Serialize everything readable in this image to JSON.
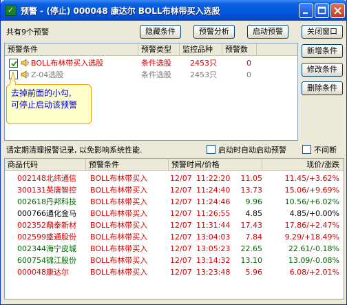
{
  "window": {
    "title": "预警 - (停止) 000048 康达尔 BOLL布林带买入选股",
    "controls": {
      "minimize": "minimize",
      "maximize": "maximize",
      "close": "close"
    }
  },
  "top_bar": {
    "count_label": "共有9个预警",
    "buttons": {
      "hide": "隐藏条件",
      "analyze": "预警分析",
      "start": "启动预警",
      "close_window": "关闭窗口"
    }
  },
  "side_buttons": {
    "add": "新增条件",
    "edit": "修改条件",
    "delete": "删除条件"
  },
  "conditions_table": {
    "columns": [
      "预警条件",
      "预警类型",
      "监控品种",
      "预警数"
    ],
    "rows": [
      {
        "name": "BOLL布林带买入选股",
        "type": "条件选股",
        "monitor": "2453只",
        "count": "0",
        "checked": true,
        "color": "red"
      },
      {
        "name": "Z-04选股",
        "type": "条件选股",
        "monitor": "2453只",
        "count": "0",
        "checked": false,
        "color": "gray"
      }
    ]
  },
  "tooltip": {
    "line1": "去掉前面的小勾,",
    "line2": "可停止启动该预警"
  },
  "options": {
    "notice": "请定期清理报警记录, 以免影响系统性能.",
    "auto_start": "启动时自动启动预警",
    "no_interrupt": "不间断"
  },
  "records_table": {
    "columns": [
      "商品代码",
      "预警条件",
      "预警时间/价格",
      "现价/涨跌"
    ],
    "rows": [
      {
        "code": "002148北纬通信",
        "cond": "BOLL布林带买入",
        "date": "12/07",
        "time": "11:22:20",
        "price": "11.05",
        "now": "11.45/+3.62%",
        "color": "red"
      },
      {
        "code": "300131英唐智控",
        "cond": "BOLL布林带买入",
        "date": "12/07",
        "time": "11:24:40",
        "price": "13.73",
        "now": "15.06/+9.69%",
        "color": "red"
      },
      {
        "code": "002618丹邦科技",
        "cond": "BOLL布林带买入",
        "date": "12/07",
        "time": "11:24:46",
        "price": "9.96",
        "now": "10.56/+6.02%",
        "color": "green"
      },
      {
        "code": "000766通化金马",
        "cond": "BOLL布林带买入",
        "date": "12/07",
        "time": "11:26:55",
        "price": "4.85",
        "now": "4.85/+0.00%",
        "color": "black"
      },
      {
        "code": "002352鼎泰新材",
        "cond": "BOLL布林带买入",
        "date": "12/07",
        "time": "11:31:44",
        "price": "17.43",
        "now": "17.86/+2.47%",
        "color": "red"
      },
      {
        "code": "002599盛通股份",
        "cond": "BOLL布林带买入",
        "date": "12/07",
        "time": "13:04:03",
        "price": "7.84",
        "now": "9.29/+18.49%",
        "color": "red"
      },
      {
        "code": "002344海宁皮城",
        "cond": "BOLL布林带买入",
        "date": "12/07",
        "time": "13:05:23",
        "price": "22.65",
        "now": "22.61/-0.18%",
        "color": "green"
      },
      {
        "code": "600754锦江股份",
        "cond": "BOLL布林带买入",
        "date": "12/07",
        "time": "13:14:32",
        "price": "13.10",
        "now": "13.09/-0.08%",
        "color": "green"
      },
      {
        "code": "000048康达尔",
        "cond": "BOLL布林带买入",
        "date": "12/07",
        "time": "13:23:48",
        "price": "5.96",
        "now": "6.08/+2.01%",
        "color": "red"
      }
    ]
  },
  "colors": {
    "up": "#d40000",
    "down": "#006600",
    "flat": "#000000",
    "titlebar": "#0558dd",
    "tooltip_bg": "#ffffcc"
  }
}
